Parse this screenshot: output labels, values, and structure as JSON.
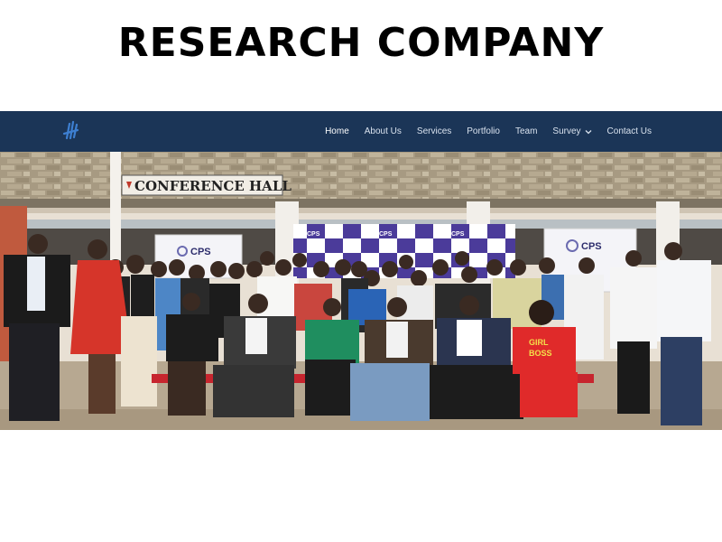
{
  "headline": "RESEARCH COMPANY",
  "nav": {
    "items": [
      {
        "label": "Home",
        "active": true
      },
      {
        "label": "About Us"
      },
      {
        "label": "Services"
      },
      {
        "label": "Portfolio"
      },
      {
        "label": "Team"
      },
      {
        "label": "Survey",
        "dropdown": true
      },
      {
        "label": "Contact Us"
      }
    ]
  },
  "photo": {
    "sign": "CONFERENCE HALL",
    "banner_brand": "CPS",
    "shirt_line1": "GIRL",
    "shirt_line2": "BOSS"
  },
  "colors": {
    "navbar": "#1b3557",
    "logo": "#3d7fd1",
    "banner_purple": "#4b3b9a"
  },
  "icons": {
    "logo": "hand-logo-icon",
    "dropdown": "chevron-down-icon"
  }
}
